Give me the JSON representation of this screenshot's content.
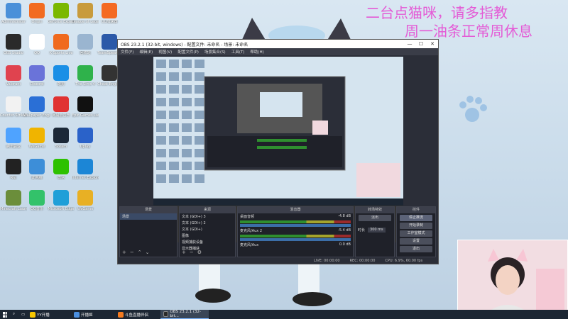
{
  "overlay": {
    "line1": "二台点猫咪，请多指教",
    "line2": "周一油条正常周休息"
  },
  "desktop_icons": [
    {
      "label": "Administrator",
      "color": "#4a90d9"
    },
    {
      "label": "OBS Studio",
      "color": "#2a2a2a"
    },
    {
      "label": "Valorant",
      "color": "#e0434f"
    },
    {
      "label": "Counter-Strike Global Offe...",
      "color": "#f2f2f2"
    },
    {
      "label": "腾讯会议",
      "color": "#4fa3ff"
    },
    {
      "label": "R星",
      "color": "#222"
    },
    {
      "label": "Minecraft Launcher",
      "color": "#6b8e3b"
    },
    {
      "label": "Origin",
      "color": "#f26b21"
    },
    {
      "label": "QQ",
      "color": "#fff"
    },
    {
      "label": "Discord",
      "color": "#6a73d9"
    },
    {
      "label": "Wallpaper Engine",
      "color": "#2a6fd6"
    },
    {
      "label": "WeGame",
      "color": "#f0b400"
    },
    {
      "label": "此电脑",
      "color": "#3d8ed8"
    },
    {
      "label": "QQ音乐",
      "color": "#33c26a"
    },
    {
      "label": "GeForce Experience",
      "color": "#7ab800"
    },
    {
      "label": "X-Sports Live",
      "color": "#f06a1e"
    },
    {
      "label": "酷狗",
      "color": "#1a8fe6"
    },
    {
      "label": "网易云音乐",
      "color": "#e03232"
    },
    {
      "label": "Steam",
      "color": "#1b2838"
    },
    {
      "label": "微信",
      "color": "#2dc100"
    },
    {
      "label": "Microsoft Edge",
      "color": "#1f9fd8"
    },
    {
      "label": "League of Legends",
      "color": "#c89b3c"
    },
    {
      "label": "回收站",
      "color": "#9ab5d0"
    },
    {
      "label": "The Sims 4",
      "color": "#2fb24b"
    },
    {
      "label": "Epic Games Launcher",
      "color": "#111"
    },
    {
      "label": "Uplay",
      "color": "#2a62c9"
    },
    {
      "label": "Internet Explorer",
      "color": "#1c86d6"
    },
    {
      "label": "WeGame",
      "color": "#e8b024"
    },
    {
      "label": "UU加速器",
      "color": "#f46a23"
    },
    {
      "label": "TeamSpeak 3",
      "color": "#2b59a8"
    },
    {
      "label": "Cheat Engine",
      "color": "#333"
    }
  ],
  "obs": {
    "title": "OBS 23.2.1 (32-bit, windows) - 配置文件: 未命名 - 场景: 未命名",
    "window_buttons": [
      "—",
      "☐",
      "✕"
    ],
    "menu": [
      "文件(F)",
      "编辑(E)",
      "视图(V)",
      "配置文件(P)",
      "场景集合(S)",
      "工具(T)",
      "帮助(H)"
    ],
    "docks": {
      "scenes": {
        "title": "场景",
        "items": [
          "场景"
        ]
      },
      "sources": {
        "title": "来源",
        "items": [
          "文本 (GDI+) 3",
          "文本 (GDI+) 2",
          "文本 (GDI+)",
          "图像",
          "视频捕获设备",
          "显示器捕获"
        ]
      },
      "mixer": {
        "title": "混音器",
        "channels": [
          {
            "name": "桌面音频",
            "db": "-4.8 dB"
          },
          {
            "name": "麦克风/Aux 2",
            "db": "-5.4 dB"
          },
          {
            "name": "麦克风/Aux",
            "db": "0.0 dB"
          }
        ]
      },
      "transitions": {
        "title": "转场特效",
        "type": "淡出",
        "duration_label": "时长",
        "duration": "300 ms"
      },
      "controls": {
        "title": "控件",
        "buttons": [
          "停止推流",
          "开始录制",
          "工作室模式",
          "设置",
          "退出"
        ]
      }
    },
    "status": {
      "live": "LIVE: 00:00:00",
      "rec": "REC: 00:00:00",
      "cpu": "CPU: 6.9%, 60.00 fps"
    }
  },
  "taskbar": {
    "items": [
      {
        "label": "YY开播",
        "color": "#f7c600",
        "active": false
      },
      {
        "label": "开播姬",
        "color": "#4a8fe0",
        "active": false
      },
      {
        "label": "斗鱼直播伴侣",
        "color": "#f47a1f",
        "active": false
      },
      {
        "label": "OBS 23.2.1 (32-bit...",
        "color": "#2a2a2a",
        "active": true
      }
    ]
  }
}
